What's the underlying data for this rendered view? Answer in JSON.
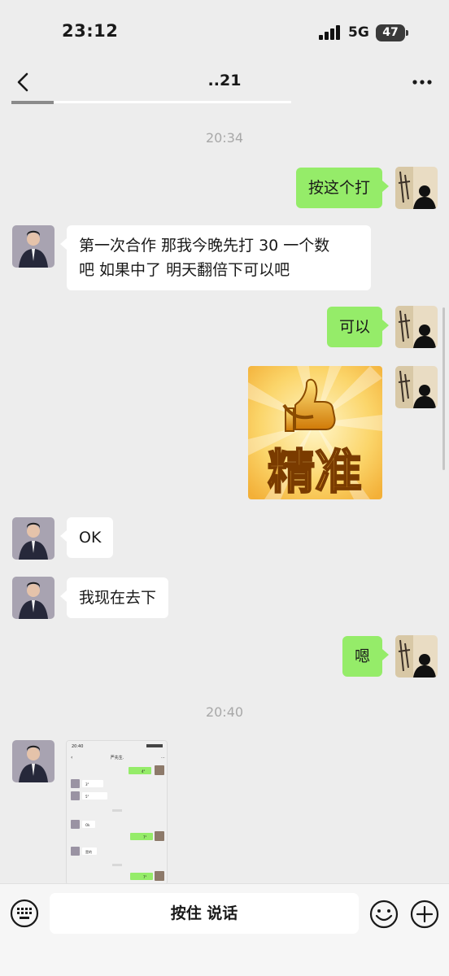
{
  "status_bar": {
    "time": "23:12",
    "network": "5G",
    "battery": "47"
  },
  "nav": {
    "title": "..21"
  },
  "messages": [
    {
      "type": "time",
      "text": "20:34"
    },
    {
      "type": "text",
      "side": "right",
      "text": "按这个打"
    },
    {
      "type": "text",
      "side": "left",
      "text": " 第一次合作  那我今晚先打 30 一个数\n吧  如果中了  明天翻倍下可以吧"
    },
    {
      "type": "text",
      "side": "right",
      "text": "可以"
    },
    {
      "type": "sticker",
      "side": "right",
      "text": "精准"
    },
    {
      "type": "text",
      "side": "left",
      "text": "OK"
    },
    {
      "type": "text",
      "side": "left",
      "text": "我现在去下"
    },
    {
      "type": "text",
      "side": "right",
      "text": "嗯"
    },
    {
      "type": "time",
      "text": "20:40"
    },
    {
      "type": "image",
      "side": "left"
    }
  ],
  "screenshot": {
    "time": "20:40",
    "title": "严先生.",
    "rows": [
      "4\"",
      "3\"",
      "5\"",
      "Ok",
      "7\"",
      "是的",
      "7\""
    ]
  },
  "input_bar": {
    "voice_label": "按住 说话"
  },
  "colors": {
    "background": "#ededed",
    "sent_bubble": "#95ec69",
    "received_bubble": "#ffffff",
    "timestamp": "#a8a8a8"
  }
}
